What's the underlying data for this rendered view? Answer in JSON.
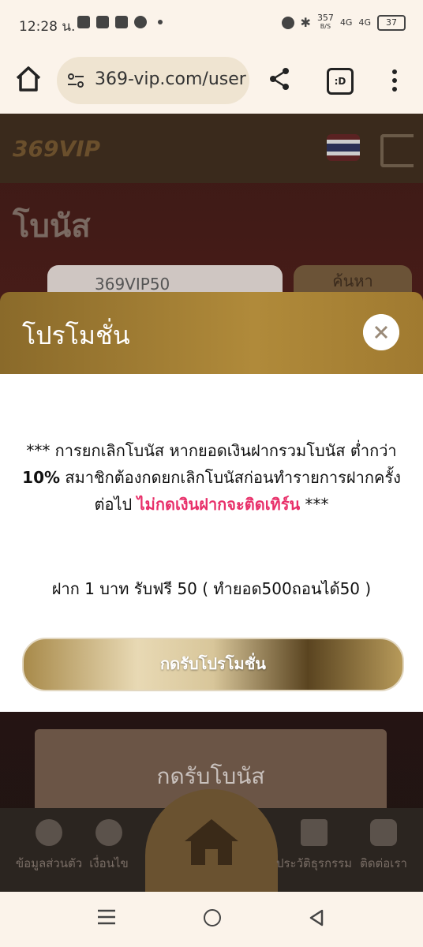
{
  "status_bar": {
    "time": "12:28 น.",
    "net_speed": "357",
    "net_unit": "B/S",
    "signal1": "4G",
    "signal2": "4G",
    "battery": "37"
  },
  "browser": {
    "url": "369-vip.com/user",
    "tabs_label": ":D"
  },
  "page": {
    "logo": "369VIP",
    "title": "โบนัส",
    "search_value": "369VIP50",
    "find_label": "ค้นหา",
    "bonus_card_label": "กดรับโบนัส",
    "nav": [
      {
        "label": "ข้อมูลส่วนตัว"
      },
      {
        "label": "เงื่อนไข"
      },
      {
        "label": "ประวัติธุรกรรม"
      },
      {
        "label": "ติดต่อเรา"
      }
    ]
  },
  "modal": {
    "title": "โปรโมชั่น",
    "msg_part1": "*** การยกเลิกโบนัส หากยอดเงินฝากรวมโบนัส ต่ำกว่า ",
    "msg_bold": "10%",
    "msg_part2": " สมาชิกต้องกดยกเลิกโบนัสก่อนทำรายการฝากครั้งต่อไป ",
    "msg_red": "ไม่กดเงินฝากจะติดเทิร์น",
    "msg_end": " ***",
    "detail": "ฝาก 1 บาท รับฟรี 50 ( ทำยอด500ถอนได้50 )",
    "claim_label": "กดรับโปรโมชั่น"
  }
}
